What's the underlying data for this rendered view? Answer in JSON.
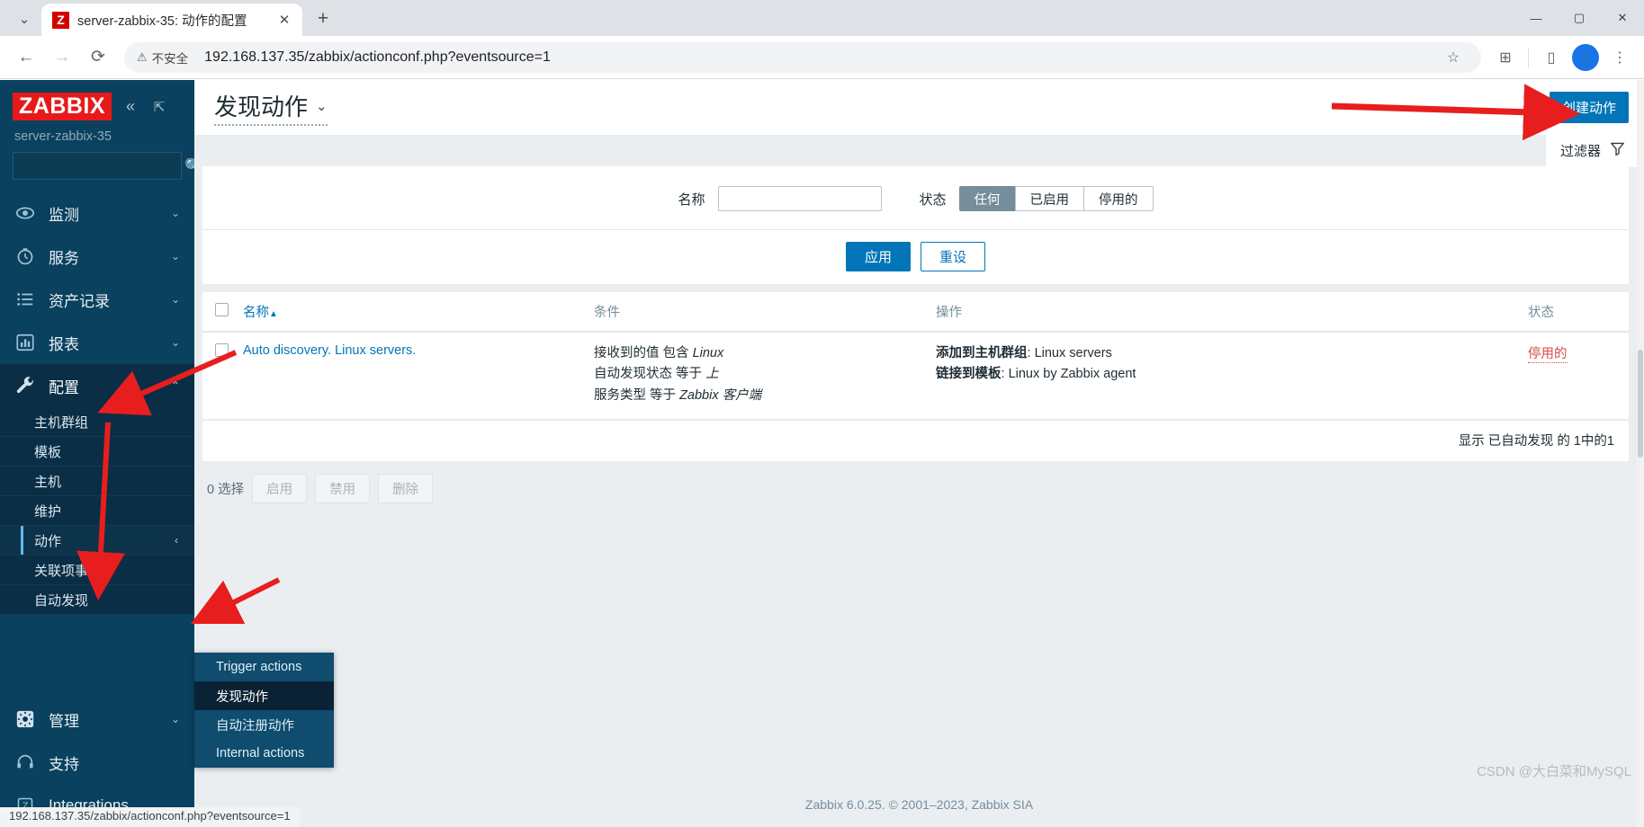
{
  "browser": {
    "tab": {
      "title": "server-zabbix-35: 动作的配置",
      "favicon_letter": "Z"
    },
    "new_tab_label": "+",
    "nav": {
      "back": "←",
      "forward": "→",
      "reload": "⟳"
    },
    "security_label": "不安全",
    "url": "192.168.137.35/zabbix/actionconf.php?eventsource=1",
    "icons": {
      "bookmark": "☆",
      "extensions": "⊞",
      "sidepanel": "▯",
      "menu": "⋮"
    },
    "window": {
      "minimize": "—",
      "maximize": "▢",
      "close": "✕"
    },
    "status_url": "192.168.137.35/zabbix/actionconf.php?eventsource=1"
  },
  "sidebar": {
    "logo": "ZABBIX",
    "collapse_icon": "«",
    "expand_icon": "⇱",
    "server_name": "server-zabbix-35",
    "search_placeholder": "",
    "search_value": "",
    "items": [
      {
        "label": "监测",
        "icon": "eye-icon",
        "arrow": "⌄"
      },
      {
        "label": "服务",
        "icon": "clock-icon",
        "arrow": "⌄"
      },
      {
        "label": "资产记录",
        "icon": "list-icon",
        "arrow": "⌄"
      },
      {
        "label": "报表",
        "icon": "chart-icon",
        "arrow": "⌄"
      },
      {
        "label": "配置",
        "icon": "wrench-icon",
        "arrow": "⌃"
      }
    ],
    "sub_items": [
      {
        "label": "主机群组"
      },
      {
        "label": "模板"
      },
      {
        "label": "主机"
      },
      {
        "label": "维护"
      },
      {
        "label": "动作",
        "caret": "‹",
        "selected": true
      },
      {
        "label": "关联项事件"
      },
      {
        "label": "自动发现"
      }
    ],
    "bottom_items": [
      {
        "label": "管理",
        "icon": "gear-icon",
        "arrow": "⌄"
      },
      {
        "label": "支持",
        "icon": "headset-icon",
        "arrow": ""
      },
      {
        "label": "Integrations",
        "icon": "zabbix-z-icon",
        "arrow": ""
      }
    ]
  },
  "flyout": {
    "items": [
      {
        "label": "Trigger actions",
        "highlight": false
      },
      {
        "label": "发现动作",
        "highlight": true
      },
      {
        "label": "自动注册动作",
        "highlight": false
      },
      {
        "label": "Internal actions",
        "highlight": false
      }
    ]
  },
  "header": {
    "title": "发现动作",
    "title_caret": "⌄",
    "create_button": "创建动作"
  },
  "filter": {
    "tab_label": "过滤器",
    "funnel_icon": "filter-icon",
    "name_label": "名称",
    "name_value": "",
    "name_placeholder": "",
    "status_label": "状态",
    "status_options": [
      "任何",
      "已启用",
      "停用的"
    ],
    "status_selected": "任何",
    "apply_label": "应用",
    "reset_label": "重设"
  },
  "table": {
    "headers": {
      "name": "名称",
      "sort_caret": "▲",
      "conditions": "条件",
      "operations": "操作",
      "status": "状态"
    },
    "rows": [
      {
        "name": "Auto discovery. Linux servers.",
        "conditions": [
          {
            "pre": "接收到的值 包含 ",
            "em": "Linux"
          },
          {
            "pre": "自动发现状态 等于 ",
            "em": "上"
          },
          {
            "pre": "服务类型 等于 ",
            "em": "Zabbix 客户端"
          }
        ],
        "operations": [
          {
            "label": "添加到主机群组",
            "value": "Linux servers"
          },
          {
            "label": "链接到模板",
            "value": "Linux by Zabbix agent"
          }
        ],
        "status": "停用的"
      }
    ],
    "footer": "显示 已自动发现 的 1中的1"
  },
  "bulk": {
    "selected_text": "0 选择",
    "buttons": [
      "启用",
      "禁用",
      "删除"
    ]
  },
  "footer": {
    "copyright": "Zabbix 6.0.25. © 2001–2023, Zabbix SIA",
    "watermark": "CSDN @大白菜和MySQL"
  },
  "colors": {
    "accent": "#0275b8",
    "sidebar": "#09415e",
    "sidebar_dark": "#0a2e45",
    "logo_red": "#e8191b",
    "status_disabled": "#d64949",
    "annotation_arrow": "#e81e1e"
  }
}
